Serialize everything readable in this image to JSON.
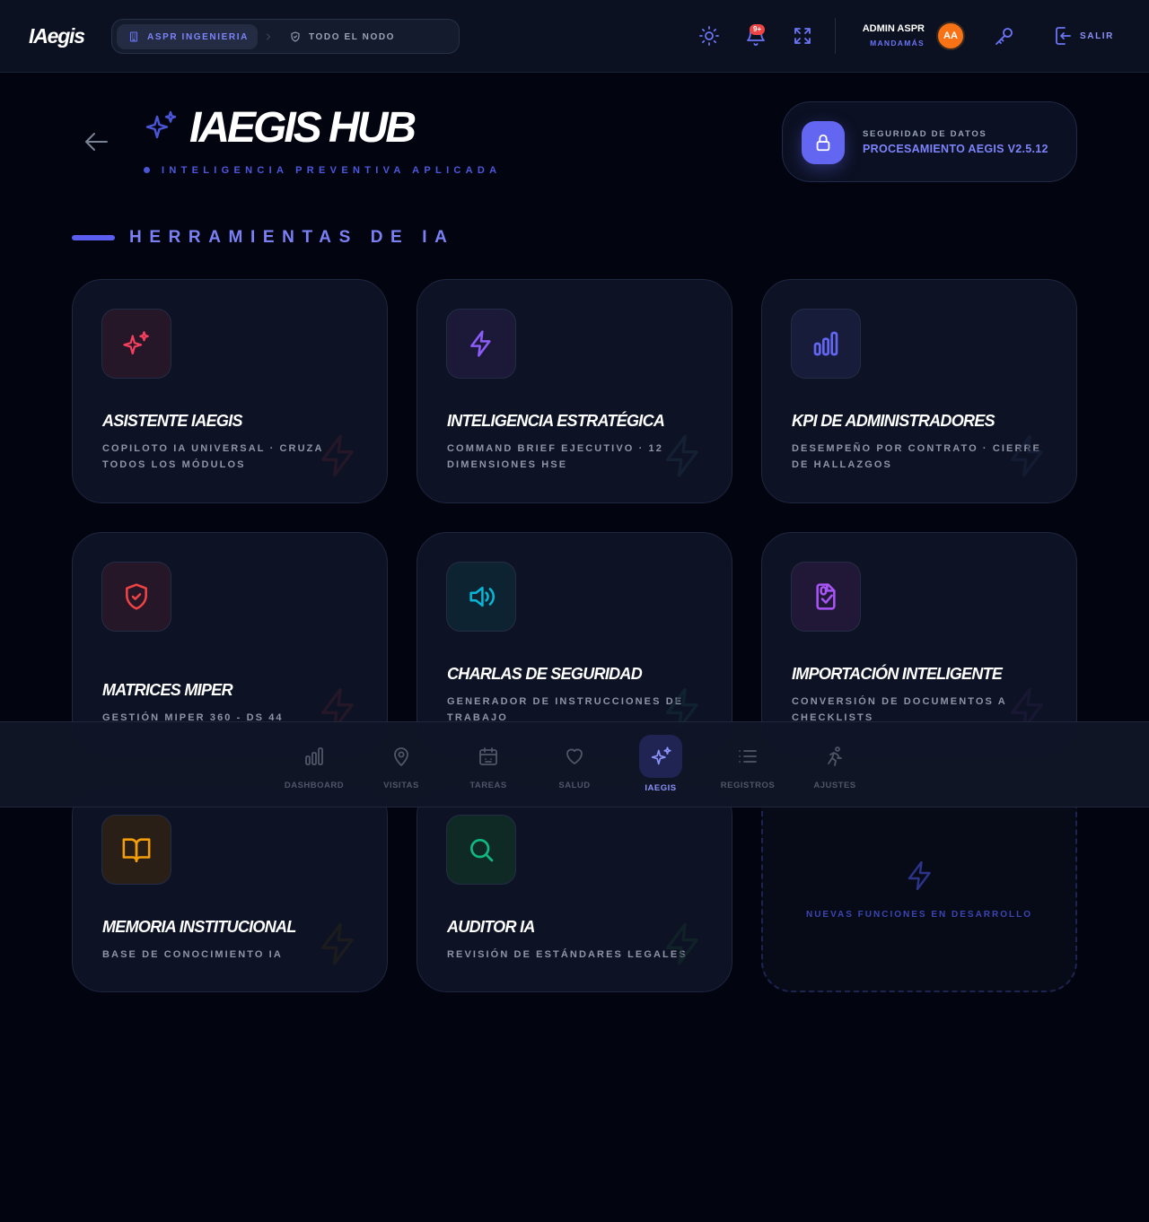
{
  "app": {
    "logo": "IAegis"
  },
  "header": {
    "breadcrumb": {
      "company": "ASPR INGENIERIA",
      "node": "TODO EL NODO"
    },
    "notification_badge": "9+",
    "user": {
      "name": "ADMIN ASPR",
      "role": "MANDAMÁS",
      "initials": "AA"
    },
    "logout_label": "SALIR"
  },
  "hero": {
    "title": "IAEGIS HUB",
    "subtitle": "INTELIGENCIA PREVENTIVA APLICADA",
    "security": {
      "kicker": "SEGURIDAD DE DATOS",
      "value": "PROCESAMIENTO AEGIS V2.5.12"
    }
  },
  "section": {
    "title": "HERRAMIENTAS DE IA"
  },
  "tools": [
    {
      "title": "ASISTENTE IAEGIS",
      "description": "COPILOTO IA UNIVERSAL · CRUZA TODOS LOS MÓDULOS",
      "icon": "sparkles-icon",
      "color": "#f43f5e"
    },
    {
      "title": "INTELIGENCIA ESTRATÉGICA",
      "description": "COMMAND BRIEF EJECUTIVO · 12 DIMENSIONES HSE",
      "icon": "bolt-icon",
      "color": "#8b5cf6"
    },
    {
      "title": "KPI DE ADMINISTRADORES",
      "description": "DESEMPEÑO POR CONTRATO · CIERRE DE HALLAZGOS",
      "icon": "bar-chart-icon",
      "color": "#6366f1"
    },
    {
      "title": "MATRICES MIPER",
      "description": "GESTIÓN MIPER 360 - DS 44",
      "icon": "shield-check-icon",
      "color": "#ef4444"
    },
    {
      "title": "CHARLAS DE SEGURIDAD",
      "description": "GENERADOR DE INSTRUCCIONES DE TRABAJO",
      "icon": "speaker-icon",
      "color": "#06b6d4"
    },
    {
      "title": "IMPORTACIÓN INTELIGENTE",
      "description": "CONVERSIÓN DE DOCUMENTOS A CHECKLISTS",
      "icon": "file-scan-icon",
      "color": "#a855f7"
    },
    {
      "title": "MEMORIA INSTITUCIONAL",
      "description": "BASE DE CONOCIMIENTO IA",
      "icon": "book-icon",
      "color": "#f59e0b"
    },
    {
      "title": "AUDITOR IA",
      "description": "REVISIÓN DE ESTÁNDARES LEGALES",
      "icon": "search-icon",
      "color": "#10b981"
    }
  ],
  "placeholder": {
    "text": "NUEVAS FUNCIONES EN DESARROLLO"
  },
  "bottom_nav": [
    {
      "label": "DASHBOARD",
      "icon": "bar-chart-icon",
      "active": false
    },
    {
      "label": "VISITAS",
      "icon": "map-pin-icon",
      "active": false
    },
    {
      "label": "TAREAS",
      "icon": "calendar-icon",
      "active": false
    },
    {
      "label": "SALUD",
      "icon": "heart-icon",
      "active": false
    },
    {
      "label": "IAEGIS",
      "icon": "sparkles-icon",
      "active": true
    },
    {
      "label": "REGISTROS",
      "icon": "list-icon",
      "active": false
    },
    {
      "label": "AJUSTES",
      "icon": "running-person-icon",
      "active": false
    }
  ],
  "colors": {
    "accent": "#6366f1",
    "background": "#02050f",
    "card": "#0d1324",
    "avatar": "#f97316",
    "badge": "#ef4444"
  }
}
